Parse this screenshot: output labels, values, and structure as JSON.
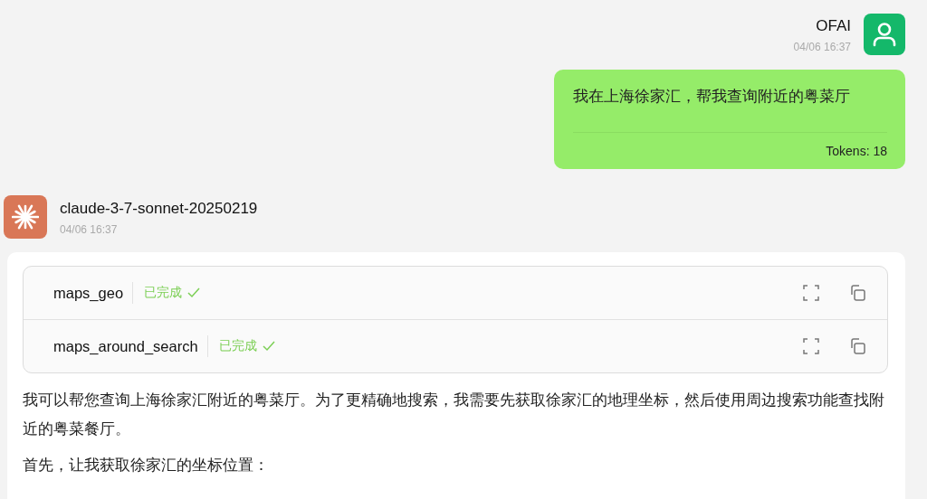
{
  "user_message": {
    "name": "OFAI",
    "time": "04/06 16:37",
    "text": "我在上海徐家汇，帮我查询附近的粤菜厅",
    "tokens": "Tokens: 18"
  },
  "assistant_message": {
    "name": "claude-3-7-sonnet-20250219",
    "time": "04/06 16:37",
    "tools": [
      {
        "name": "maps_geo",
        "status": "已完成",
        "done": true
      },
      {
        "name": "maps_around_search",
        "status": "已完成",
        "done": true
      }
    ],
    "paragraphs": [
      "我可以帮您查询上海徐家汇附近的粤菜厅。为了更精确地搜索，我需要先获取徐家汇的地理坐标，然后使用周边搜索功能查找附近的粤菜餐厅。",
      "首先，让我获取徐家汇的坐标位置："
    ]
  }
}
